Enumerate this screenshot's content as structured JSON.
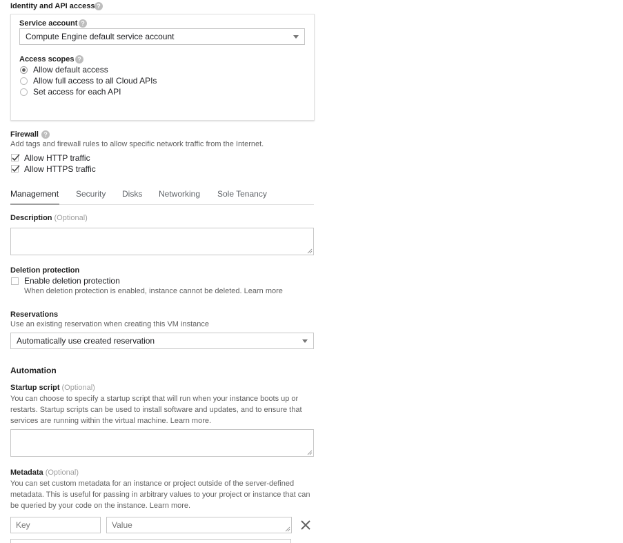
{
  "identity": {
    "title": "Identity and API access",
    "service_account": {
      "label": "Service account",
      "value": "Compute Engine default service account"
    },
    "access_scopes": {
      "label": "Access scopes",
      "options": [
        {
          "label": "Allow default access",
          "selected": true
        },
        {
          "label": "Allow full access to all Cloud APIs",
          "selected": false
        },
        {
          "label": "Set access for each API",
          "selected": false
        }
      ]
    }
  },
  "firewall": {
    "title": "Firewall",
    "description": "Add tags and firewall rules to allow specific network traffic from the Internet.",
    "options": [
      {
        "label": "Allow HTTP traffic",
        "checked": true
      },
      {
        "label": "Allow HTTPS traffic",
        "checked": true
      }
    ]
  },
  "tabs": [
    {
      "label": "Management",
      "active": true
    },
    {
      "label": "Security",
      "active": false
    },
    {
      "label": "Disks",
      "active": false
    },
    {
      "label": "Networking",
      "active": false
    },
    {
      "label": "Sole Tenancy",
      "active": false
    }
  ],
  "description_field": {
    "label": "Description",
    "optional": "(Optional)",
    "value": ""
  },
  "deletion_protection": {
    "title": "Deletion protection",
    "checkbox_label": "Enable deletion protection",
    "checked": false,
    "help": "When deletion protection is enabled, instance cannot be deleted.",
    "learn_more": "Learn more"
  },
  "reservations": {
    "title": "Reservations",
    "description": "Use an existing reservation when creating this VM instance",
    "value": "Automatically use created reservation"
  },
  "automation": {
    "title": "Automation",
    "startup_script": {
      "label": "Startup script",
      "optional": "(Optional)",
      "description_lines": [
        "You can choose to specify a startup script that will run when your instance boots up or",
        "restarts. Startup scripts can be used to install software and updates, and to ensure that",
        "services are running within the virtual machine. Learn more."
      ]
    },
    "metadata": {
      "label": "Metadata",
      "optional": "(Optional)",
      "description_lines": [
        "You can set custom metadata for an instance or project outside of the server-defined",
        "metadata. This is useful for passing in arbitrary values to your project or instance that can",
        "be queried by your code on the instance. Learn more."
      ],
      "key_placeholder": "Key",
      "value_placeholder": "Value"
    }
  },
  "icons": {
    "help": "help-icon",
    "dropdown": "chevron-down-icon",
    "remove": "close-icon",
    "resize": "resize-grip-icon"
  },
  "colors": {
    "text": "#202124",
    "muted": "#616161",
    "border": "#c6c6c6",
    "tab_underline": "#9e9e9e"
  }
}
